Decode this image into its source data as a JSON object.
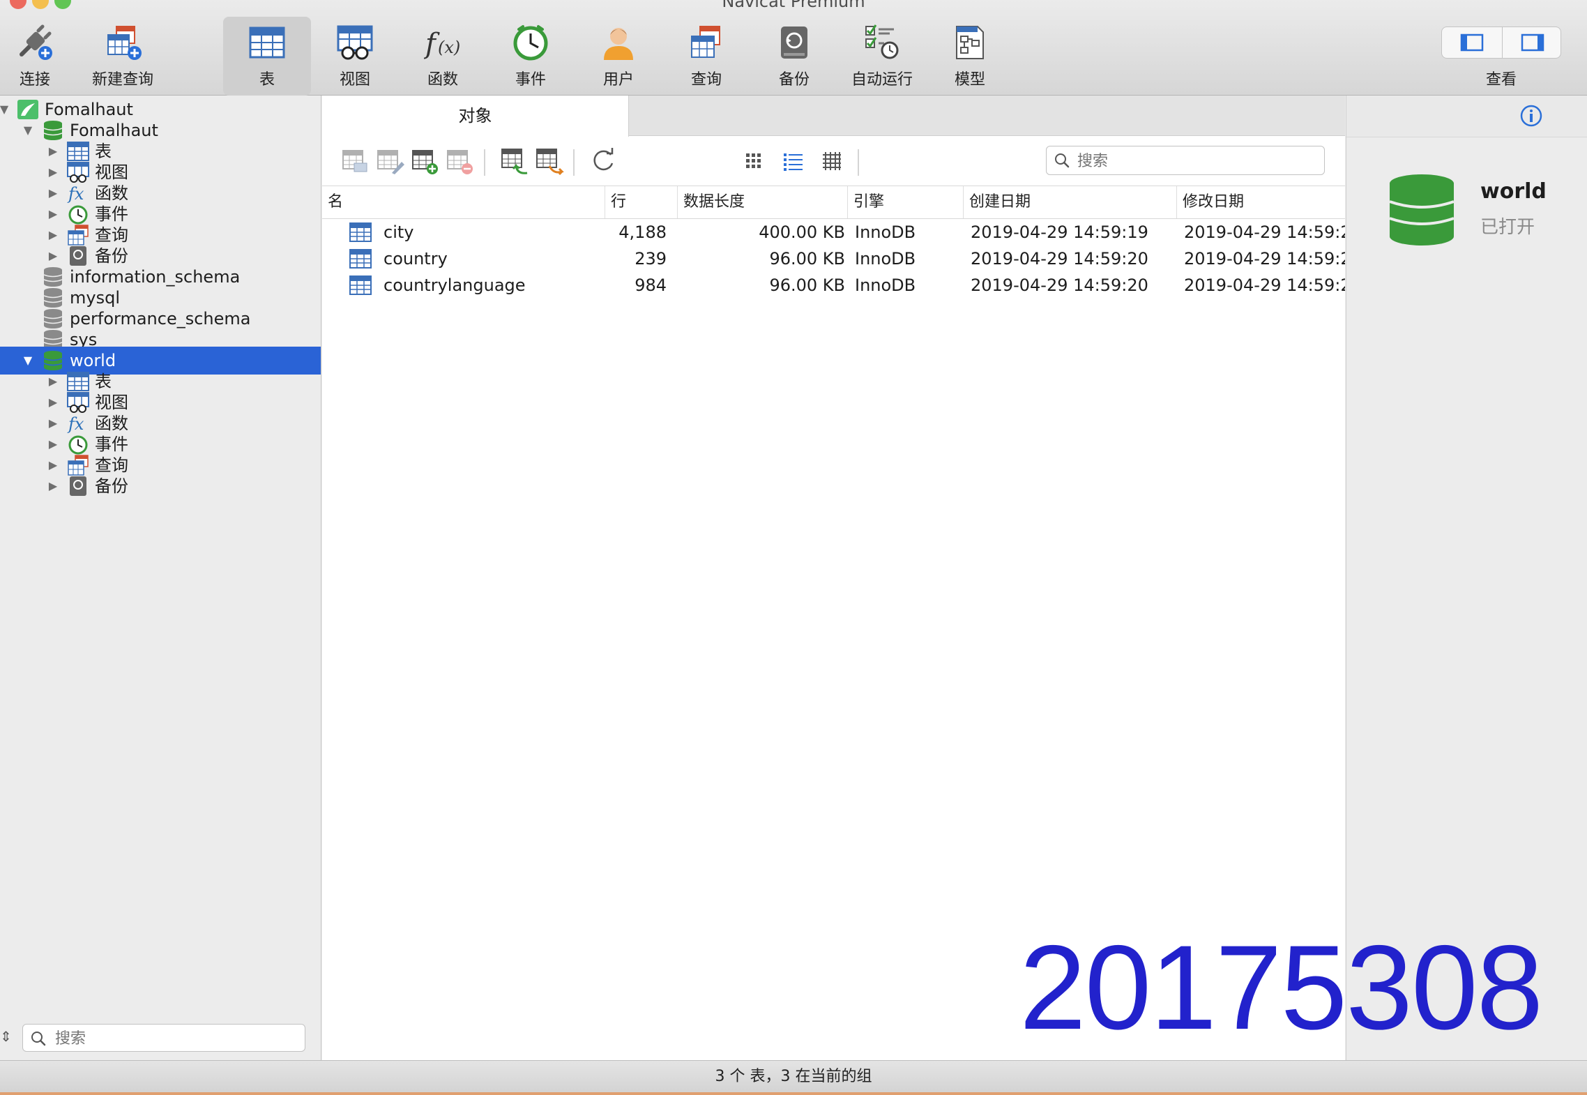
{
  "window": {
    "title": "Navicat Premium"
  },
  "toolbar": {
    "buttons": [
      {
        "label": "连接",
        "icon": "plug-icon"
      },
      {
        "label": "新建查询",
        "icon": "new-query-icon"
      },
      {
        "label": "表",
        "icon": "table-icon"
      },
      {
        "label": "视图",
        "icon": "view-icon"
      },
      {
        "label": "函数",
        "icon": "function-icon"
      },
      {
        "label": "事件",
        "icon": "clock-icon"
      },
      {
        "label": "用户",
        "icon": "user-icon"
      },
      {
        "label": "查询",
        "icon": "query-icon"
      },
      {
        "label": "备份",
        "icon": "backup-icon"
      },
      {
        "label": "自动运行",
        "icon": "automation-icon"
      },
      {
        "label": "模型",
        "icon": "model-icon"
      }
    ],
    "view_label": "查看"
  },
  "sidebar": {
    "connection": "Fomalhaut",
    "db_fomalhaut": {
      "name": "Fomalhaut",
      "children": [
        "表",
        "视图",
        "函数",
        "事件",
        "查询",
        "备份"
      ]
    },
    "databases": [
      "information_schema",
      "mysql",
      "performance_schema",
      "sys"
    ],
    "db_world": {
      "name": "world",
      "children": [
        "表",
        "视图",
        "函数",
        "事件",
        "查询",
        "备份"
      ]
    },
    "search_placeholder": "搜索"
  },
  "main": {
    "tab": "对象",
    "search_placeholder": "搜索",
    "columns": [
      "名",
      "行",
      "数据长度",
      "引擎",
      "创建日期",
      "修改日期"
    ],
    "rows": [
      [
        "city",
        "4,188",
        "400.00 KB",
        "InnoDB",
        "2019-04-29 14:59:19",
        "2019-04-29 14:59:2"
      ],
      [
        "country",
        "239",
        "96.00 KB",
        "InnoDB",
        "2019-04-29 14:59:20",
        "2019-04-29 14:59:2"
      ],
      [
        "countrylanguage",
        "984",
        "96.00 KB",
        "InnoDB",
        "2019-04-29 14:59:20",
        "2019-04-29 14:59:2"
      ]
    ]
  },
  "info_panel": {
    "name": "world",
    "status": "已打开"
  },
  "watermark": "20175308",
  "status_bar": "3 个 表，3 在当前的组",
  "colors": {
    "selection": "#2a63d6",
    "db_green": "#3a9a3a",
    "accent_blue": "#2a6fd8",
    "watermark": "#2222cc"
  }
}
